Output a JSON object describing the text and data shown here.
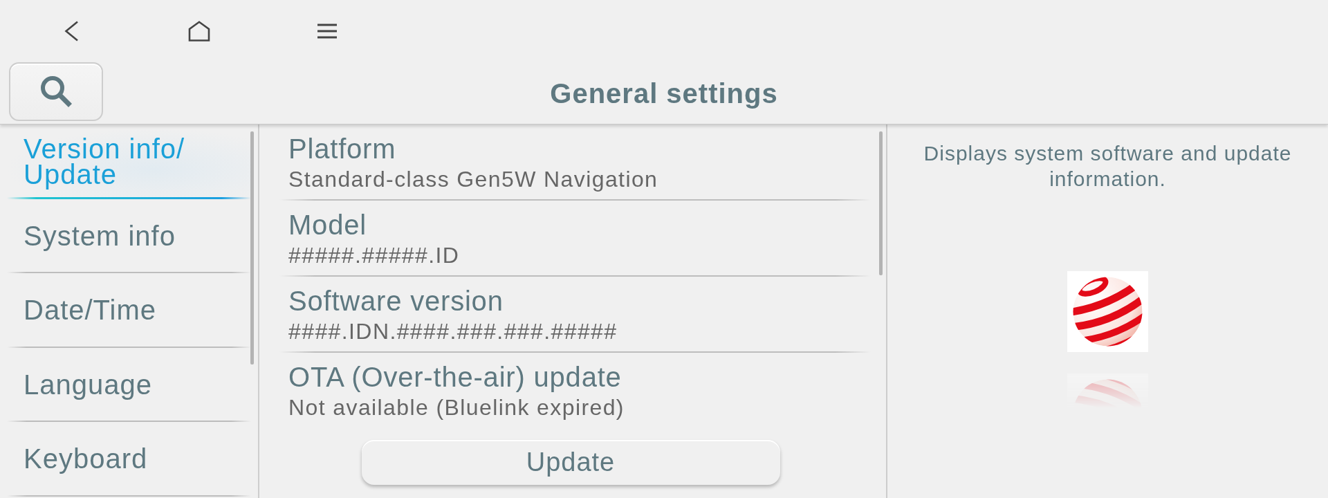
{
  "header": {
    "title": "General settings"
  },
  "sidebar": {
    "items": [
      {
        "label": "Version info/Update",
        "selected": true
      },
      {
        "label": "System info",
        "selected": false
      },
      {
        "label": "Date/Time",
        "selected": false
      },
      {
        "label": "Language",
        "selected": false
      },
      {
        "label": "Keyboard",
        "selected": false
      }
    ]
  },
  "details": {
    "items": [
      {
        "label": "Platform",
        "value": "Standard-class Gen5W Navigation"
      },
      {
        "label": "Model",
        "value": "#####.#####.ID"
      },
      {
        "label": "Software version",
        "value": "####.IDN.####.###.###.#####"
      },
      {
        "label": "OTA (Over-the-air) update",
        "value": "Not available (Bluelink expired)"
      }
    ],
    "update_button": {
      "label": "Update"
    }
  },
  "help_panel": {
    "description": "Displays system software and update information."
  }
}
